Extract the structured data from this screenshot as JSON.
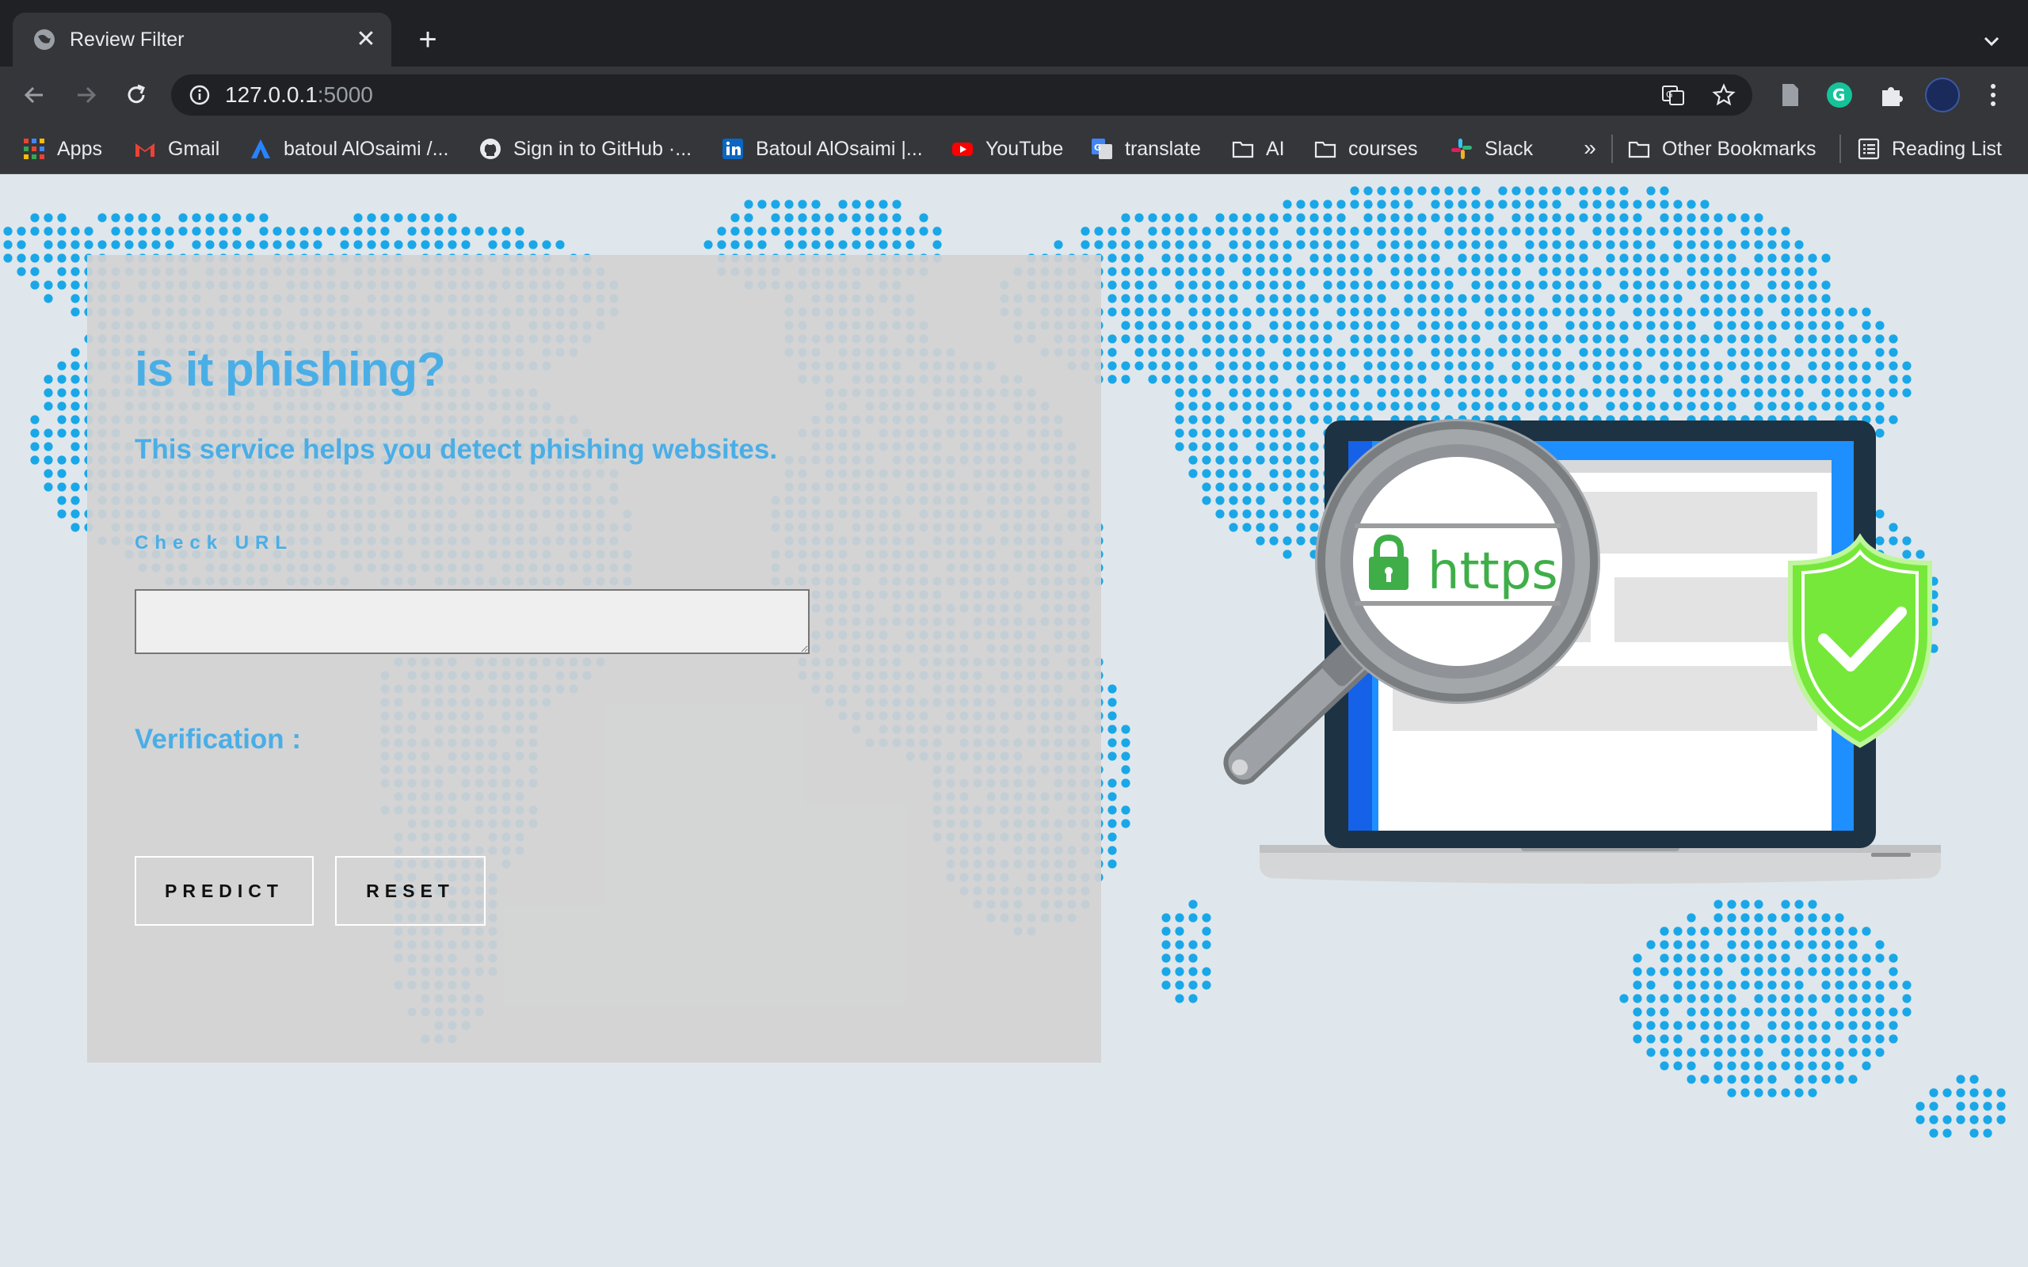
{
  "browser": {
    "tab_title": "Review Filter",
    "url_host": "127.0.0.1",
    "url_port": ":5000",
    "bookmarks": [
      {
        "label": "Apps"
      },
      {
        "label": "Gmail"
      },
      {
        "label": "batoul AlOsaimi /..."
      },
      {
        "label": "Sign in to GitHub ·..."
      },
      {
        "label": "Batoul AlOsaimi |..."
      },
      {
        "label": "YouTube"
      },
      {
        "label": "translate"
      },
      {
        "label": "AI"
      },
      {
        "label": "courses"
      },
      {
        "label": "Slack"
      }
    ],
    "more_label": "»",
    "other_bookmarks": "Other Bookmarks",
    "reading_list": "Reading List"
  },
  "form": {
    "title": "is it phishing?",
    "subtitle": "This service helps you detect phishing websites.",
    "input_label": "Check URL",
    "input_value": "",
    "verification_label": "Verification :",
    "predict_label": "PREDICT",
    "reset_label": "RESET"
  },
  "illustration": {
    "badge_text": "https"
  },
  "colors": {
    "accent": "#4aaee6",
    "dots": "#1aa7e8",
    "shield": "#76e83a",
    "https_green": "#3fae49"
  }
}
